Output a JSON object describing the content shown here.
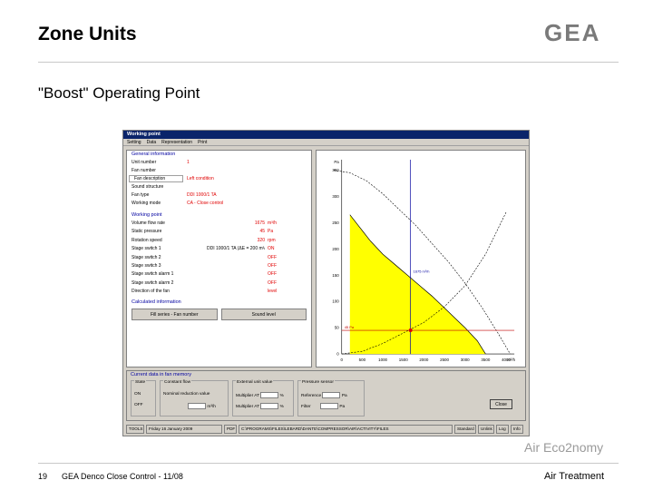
{
  "slide": {
    "title": "Zone Units",
    "subtitle": "\"Boost\" Operating Point",
    "logo_text": "GEA",
    "brand_tagline": "Air Eco2nomy",
    "page_number": "19",
    "footer_text": "GEA Denco Close Control - 11/08",
    "footer_right": "Air Treatment"
  },
  "window": {
    "title": "Working point",
    "menu": [
      "Setting",
      "Data",
      "Representation",
      "Print"
    ],
    "general_info": {
      "header": "General information",
      "rows": [
        {
          "label": "Unit number",
          "value": "1"
        },
        {
          "label": "Fan number",
          "value": ""
        },
        {
          "label": "Fan description",
          "value": "Left condition"
        },
        {
          "label": "Sound structure",
          "value": ""
        },
        {
          "label": "Fan type",
          "value": "DDI 1000/1 TA"
        },
        {
          "label": "Working mode",
          "value": "CA - Close control"
        }
      ]
    },
    "working_point": {
      "header": "Working point",
      "rows": [
        {
          "label": "Volume flow rate",
          "value": "1675",
          "unit": "m³/h"
        },
        {
          "label": "Static pressure",
          "value": "45",
          "unit": "Pa"
        },
        {
          "label": "Rotation speed",
          "value": "320",
          "unit": "rpm"
        },
        {
          "label": "Stage switch 1",
          "value": "DDI 1000/1 TA (ΔE = 200 m³/h)",
          "unit": "ON"
        },
        {
          "label": "Stage switch 2",
          "value": "",
          "unit": "OFF"
        },
        {
          "label": "Stage switch 3",
          "value": "",
          "unit": "OFF"
        },
        {
          "label": "Stage switch alarm 1",
          "value": "",
          "unit": "OFF"
        },
        {
          "label": "Stage switch alarm 2",
          "value": "",
          "unit": "OFF"
        },
        {
          "label": "Direction of the fan",
          "value": "",
          "unit": "level"
        }
      ]
    },
    "calculated": {
      "header": "Calculated information",
      "buttons": [
        "Fill series - Fan number",
        "Sound level"
      ]
    },
    "current_data": {
      "header": "Current data in fan memory",
      "state": {
        "title": "State",
        "on": "ON",
        "off": "OFF"
      },
      "constant_flow": {
        "title": "Constant flow",
        "line1": "Nominal reduction value",
        "line2_unit": "m³/h"
      },
      "external_units": {
        "title": "External unit value",
        "line1": "Multiplier AT",
        "line1_unit": "%",
        "line2": "Multiplier AT",
        "line2_unit": "%"
      },
      "pressure_sensor": {
        "title": "Pressure sensor",
        "line1": "Reference",
        "line1_unit": "Pa",
        "line2": "Filter",
        "line2_unit": "Pa"
      },
      "close_button": "Close"
    },
    "statusbar": [
      "TOOLS",
      "Friday 16 January 2009",
      "PDF",
      "C:\\PROGRAMS\\FILES\\LEBARD\\DANTE\\COMPRESSOR\\AIR\\ACTIVITY\\FILES",
      "Standard",
      "Unlink",
      "Log",
      "Info"
    ]
  },
  "chart_data": {
    "type": "line",
    "ylabel": "Pa",
    "xlabel": "m³/h",
    "y_ticks": [
      "350",
      "300",
      "250",
      "200",
      "150",
      "100",
      "50",
      "0"
    ],
    "x_ticks": [
      "0",
      "500",
      "1000",
      "1500",
      "2000",
      "2500",
      "3000",
      "3500",
      "4000"
    ],
    "xlim": [
      0,
      4200
    ],
    "ylim": [
      0,
      370
    ],
    "fan_curve": {
      "x": [
        200,
        400,
        700,
        1000,
        1300,
        1600,
        1900,
        2200,
        2600,
        3000,
        3300,
        3500
      ],
      "y": [
        265,
        245,
        215,
        190,
        170,
        150,
        130,
        110,
        80,
        50,
        25,
        0
      ]
    },
    "system_curve": {
      "x": [
        0,
        500,
        1000,
        1500,
        2000,
        2500,
        3000,
        3500,
        4000
      ],
      "y": [
        0,
        5,
        20,
        40,
        60,
        90,
        130,
        190,
        270
      ]
    },
    "envelope": {
      "x": [
        -200,
        200,
        600,
        1000,
        1400,
        1800,
        2200,
        2600,
        3000,
        3400,
        3800,
        4100
      ],
      "y": [
        350,
        345,
        330,
        305,
        275,
        245,
        210,
        175,
        135,
        90,
        40,
        0
      ]
    },
    "operating_point": {
      "x": 1675,
      "y": 45
    },
    "max_label": "1675 m³/h",
    "pressure_label": "45 Pa",
    "fill_color": "#ffff00",
    "envelope_color": "#000000",
    "fan_curve_color": "#000000",
    "crosshair_v_color": "#0000a0",
    "crosshair_h_color": "#c00000",
    "point_color": "#e00000"
  }
}
